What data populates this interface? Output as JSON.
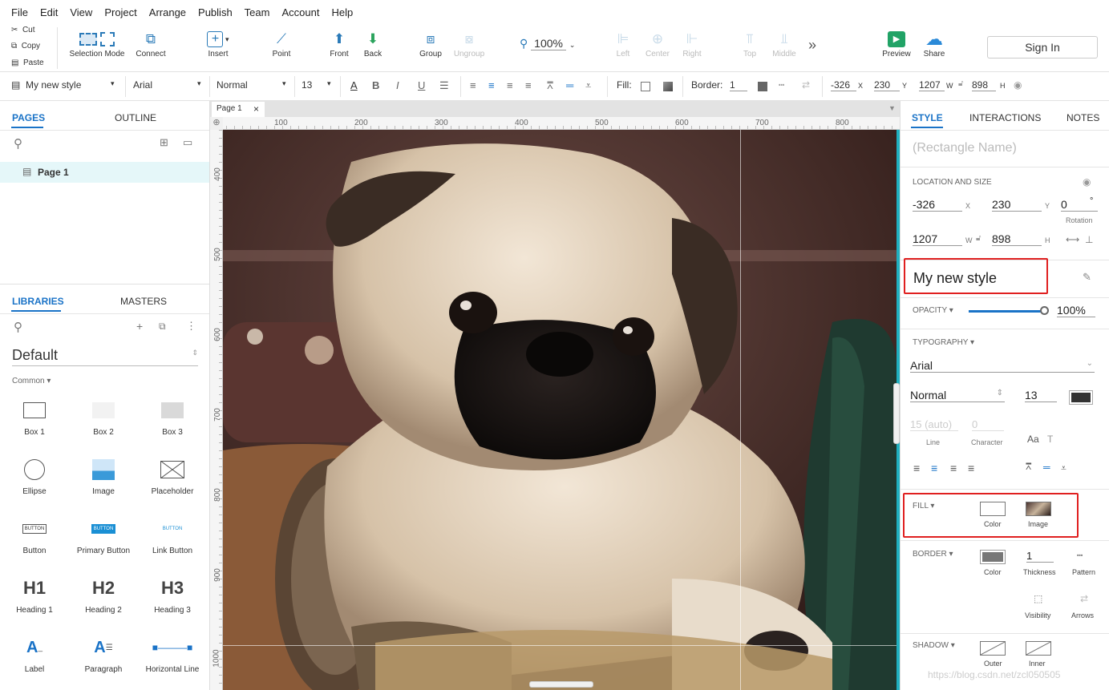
{
  "menu": [
    "File",
    "Edit",
    "View",
    "Project",
    "Arrange",
    "Publish",
    "Team",
    "Account",
    "Help"
  ],
  "clipboard": {
    "cut": "Cut",
    "copy": "Copy",
    "paste": "Paste"
  },
  "toolbar": {
    "selection_mode": "Selection Mode",
    "connect": "Connect",
    "insert": "Insert",
    "point": "Point",
    "front": "Front",
    "back": "Back",
    "group": "Group",
    "ungroup": "Ungroup",
    "zoom": "100%",
    "left": "Left",
    "center": "Center",
    "right": "Right",
    "top": "Top",
    "middle": "Middle",
    "preview": "Preview",
    "share": "Share",
    "sign_in": "Sign In"
  },
  "format": {
    "style": "My new style",
    "font": "Arial",
    "weight": "Normal",
    "size": "13",
    "fill_label": "Fill:",
    "border_label": "Border:",
    "border_value": "1",
    "x": "-326",
    "x_l": "X",
    "y": "230",
    "y_l": "Y",
    "w": "1207",
    "w_l": "W",
    "h": "898",
    "h_l": "H"
  },
  "pages": {
    "tab_pages": "PAGES",
    "tab_outline": "OUTLINE",
    "page_name": "Page 1"
  },
  "libraries": {
    "tab_libraries": "LIBRARIES",
    "tab_masters": "MASTERS",
    "library": "Default",
    "group": "Common ▾",
    "items": [
      "Box 1",
      "Box 2",
      "Box 3",
      "Ellipse",
      "Image",
      "Placeholder",
      "Button",
      "Primary Button",
      "Link Button",
      "Heading 1",
      "Heading 2",
      "Heading 3",
      "Label",
      "Paragraph",
      "Horizontal Line"
    ],
    "button_text": "BUTTON",
    "h1": "H1",
    "h2": "H2",
    "h3": "H3"
  },
  "canvas": {
    "tab": "Page 1",
    "ruler_x": [
      "100",
      "200",
      "300",
      "400",
      "500",
      "600",
      "700",
      "800"
    ],
    "ruler_y": [
      "400",
      "500",
      "600",
      "700",
      "800",
      "900",
      "1000"
    ]
  },
  "style_panel": {
    "tab_style": "STYLE",
    "tab_interactions": "INTERACTIONS",
    "tab_notes": "NOTES",
    "name_placeholder": "(Rectangle Name)",
    "location_title": "LOCATION AND SIZE",
    "x": "-326",
    "x_l": "X",
    "y": "230",
    "y_l": "Y",
    "rotation": "0",
    "rotation_unit": "°",
    "rotation_l": "Rotation",
    "w": "1207",
    "w_l": "W",
    "h": "898",
    "h_l": "H",
    "style_name": "My new style",
    "opacity_title": "OPACITY ▾",
    "opacity": "100%",
    "opacity_level": 1.0,
    "typography_title": "TYPOGRAPHY ▾",
    "font": "Arial",
    "weight": "Normal",
    "size": "13",
    "line": "15 (auto)",
    "line_l": "Line",
    "character": "0",
    "character_l": "Character",
    "fill_title": "FILL ▾",
    "fill_color": "Color",
    "fill_image": "Image",
    "border_title": "BORDER ▾",
    "border_color": "Color",
    "thickness": "1",
    "thickness_l": "Thickness",
    "pattern": "Pattern",
    "visibility": "Visibility",
    "arrows": "Arrows",
    "shadow_title": "SHADOW ▾",
    "outer": "Outer",
    "inner": "Inner",
    "watermark": "https://blog.csdn.net/zcl050505"
  },
  "colors": {
    "accent": "#1a73c7",
    "highlight_red": "#e02020",
    "preview_green": "#21a366",
    "text_color_swatch": "#333333"
  }
}
